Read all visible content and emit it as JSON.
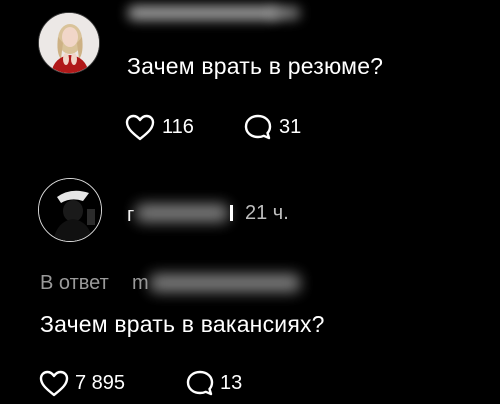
{
  "post1": {
    "text": "Зачем врать в резюме?",
    "likes": "116",
    "replies": "31"
  },
  "post2": {
    "author_initial": "г",
    "time": "21 ч.",
    "reply_prefix": "В ответ",
    "reply_user_partial": "m",
    "text": "Зачем врать в вакансиях?",
    "likes": "7 895",
    "replies": "13"
  },
  "icons": {
    "like": "heart-icon",
    "reply": "speech-bubble-icon"
  },
  "colors": {
    "background": "#000000",
    "text": "#ffffff",
    "muted": "#9a9a9a",
    "avatar_accent": "#b01818"
  }
}
